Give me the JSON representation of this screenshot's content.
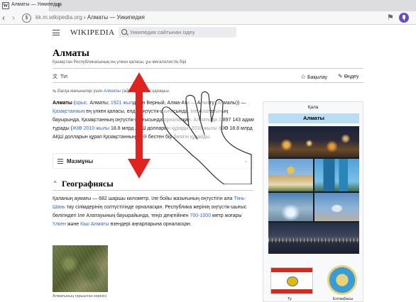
{
  "browser": {
    "tab_title": "Алматы — Уикипедия",
    "new_tab_symbol": "+",
    "url_host": "kk.m.wikipedia.org",
    "url_separator": " › ",
    "url_page": "Алматы — Уикипедия"
  },
  "header": {
    "wordmark": "WIKIPEDIA",
    "search_placeholder": "Уикипедия сайтынан іздеу"
  },
  "article": {
    "title": "Алматы",
    "tagline": "Қазақстан Республикасының ең үлкен қаласы, ұш мегаполистің бірі",
    "tools": {
      "language": "Тіл",
      "watch": "Бақылау",
      "edit": "Өңдеу"
    },
    "hatnote": {
      "before": "Басқа мағыналар үшін ",
      "link": "Алматы",
      "after": " (айрық) бетті қараңыз."
    },
    "lead": {
      "name": "Алматы",
      "p1": " (",
      "l1": "орыс.",
      "p2": " Алматы; ",
      "l2": "1921 жыл",
      "p3": "дейін Верный, Алма-Ата — Алмату (Алмалы)) — ",
      "l3": "Қазақстанның",
      "p4": " ең үлкен қаласы, елдің оңтүстік-шығысында, Іле Алатауының бауырында, Қазақстанның оңтүстік-шығысында орналасқан. Алматыда 1 897 143 адам тұрады (",
      "l4": "ЖІӨ",
      "p5": " ",
      "l5": "2010 жылы",
      "p6": " 18.8 млрд АҚШ долларын құрады. 2010 жылы ЖІӨ 18.8 млрд АҚШ долларын құрап Қазақстанның ",
      "l6": "ЖІӨ",
      "p7": " бестен бір бөлігін құрайды."
    },
    "toc_label": "Мазмұны",
    "section_title": "Географиясы",
    "geo": {
      "t1": "Қаланың аумағы — 682 шаршы километр. Іле бойы жазығының оңтүстігін ала ",
      "l1": "Тянь-Шань",
      "t2": " тау сілімдерінің солтүстігінде орналасқан. Республика жерінің оңтүстік-шығыс бөлігіндегі Іле Алатауының бауырайында, теңіз деңгейінен ",
      "l2": "700-1000",
      "t3": " метр жоғары ",
      "l3": "Үлкен",
      "t4": " және ",
      "l4": "Кіші Алматы",
      "t5": " өзендері аңғарларына орналасқан."
    },
    "photo_caption": "Алматының ғарыштан көрінісі"
  },
  "infobox": {
    "type": "Қала",
    "name": "Алматы",
    "flag_label": "Ту",
    "emblem_label": "Елтаңбасы"
  },
  "colors": {
    "link": "#3366cc",
    "infobox_header": "#b9ddf3",
    "arrow": "#e0231e",
    "voice_button": "#6a4cc2"
  },
  "overlay": {
    "arrow_direction": "vertical",
    "gesture": "scroll-up-down hand"
  }
}
